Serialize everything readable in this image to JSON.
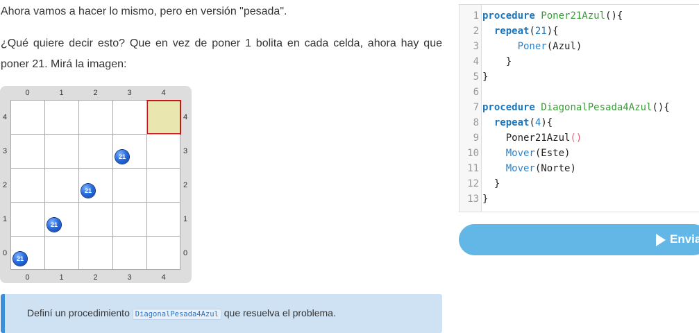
{
  "intro": {
    "line1": "Ahora vamos a hacer lo mismo, pero en versión \"pesada\".",
    "line2a": "¿Qué quiere decir esto? Que en vez de poner 1 bolita en cada celda, ahora hay que",
    "line2b": "poner 21. Mirá la imagen:"
  },
  "board": {
    "columns": [
      "0",
      "1",
      "2",
      "3",
      "4"
    ],
    "rows": [
      "4",
      "3",
      "2",
      "1",
      "0"
    ],
    "ball_color": "#2a6fe0",
    "target_cell": {
      "col": 4,
      "row": 4
    },
    "balls": [
      {
        "col": 0,
        "row": 0,
        "count": "21"
      },
      {
        "col": 1,
        "row": 1,
        "count": "21"
      },
      {
        "col": 2,
        "row": 2,
        "count": "21"
      },
      {
        "col": 3,
        "row": 3,
        "count": "21"
      }
    ]
  },
  "info": {
    "prefix": "Definí un procedimiento",
    "code": "DiagonalPesada4Azul",
    "suffix": "que resuelva el problema."
  },
  "editor": {
    "line_numbers": [
      "1",
      "2",
      "3",
      "4",
      "5",
      "6",
      "7",
      "8",
      "9",
      "10",
      "11",
      "12",
      "13"
    ],
    "lines": [
      [
        {
          "t": "procedure",
          "c": "kw"
        },
        {
          "t": " "
        },
        {
          "t": "Poner21Azul",
          "c": "fn"
        },
        {
          "t": "(){"
        }
      ],
      [
        {
          "t": "  "
        },
        {
          "t": "repeat",
          "c": "kw"
        },
        {
          "t": "("
        },
        {
          "t": "21",
          "c": "num"
        },
        {
          "t": "){"
        }
      ],
      [
        {
          "t": "      "
        },
        {
          "t": "Poner",
          "c": "bi"
        },
        {
          "t": "(Azul)"
        }
      ],
      [
        {
          "t": "    }"
        }
      ],
      [
        {
          "t": "}"
        }
      ],
      [
        {
          "t": ""
        }
      ],
      [
        {
          "t": "procedure",
          "c": "kw"
        },
        {
          "t": " "
        },
        {
          "t": "DiagonalPesada4Azul",
          "c": "fn"
        },
        {
          "t": "(){"
        }
      ],
      [
        {
          "t": "  "
        },
        {
          "t": "repeat",
          "c": "kw"
        },
        {
          "t": "("
        },
        {
          "t": "4",
          "c": "num"
        },
        {
          "t": "){"
        }
      ],
      [
        {
          "t": "    Poner21Azul"
        },
        {
          "t": "()",
          "c": "pp"
        }
      ],
      [
        {
          "t": "    "
        },
        {
          "t": "Mover",
          "c": "bi"
        },
        {
          "t": "(Este)"
        }
      ],
      [
        {
          "t": "    "
        },
        {
          "t": "Mover",
          "c": "bi"
        },
        {
          "t": "(Norte)"
        }
      ],
      [
        {
          "t": "  }"
        }
      ],
      [
        {
          "t": "}"
        }
      ]
    ]
  },
  "send": {
    "label": "Enviar",
    "color": "#63b7e6",
    "icon": "play-icon"
  }
}
